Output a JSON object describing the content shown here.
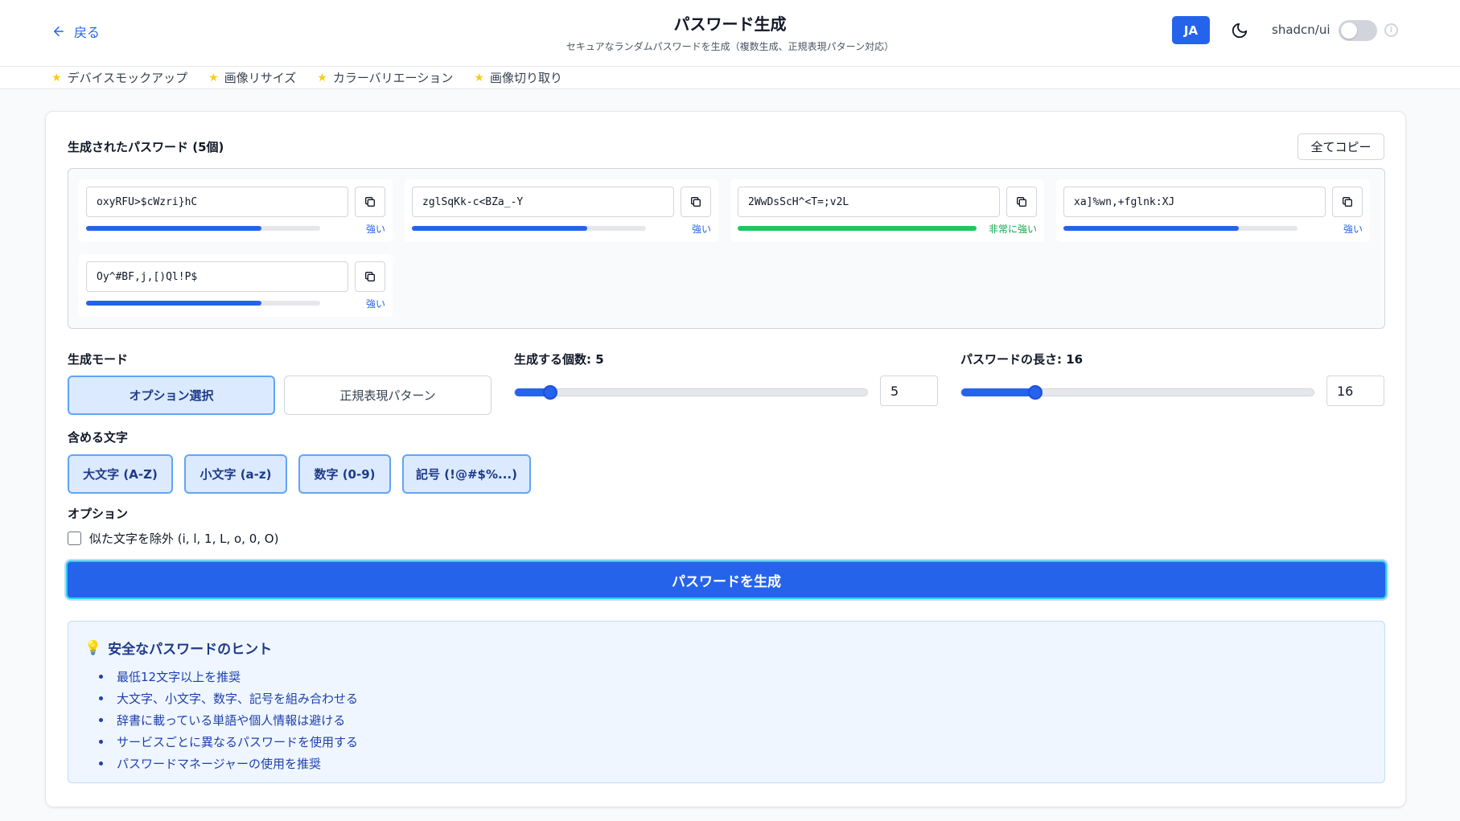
{
  "header": {
    "back_label": "戻る",
    "title": "パスワード生成",
    "subtitle": "セキュアなランダムパスワードを生成（複数生成、正規表現パターン対応）",
    "lang_button": "JA",
    "shadcn_label": "shadcn/ui",
    "shadcn_enabled": false
  },
  "favorites": [
    {
      "label": "デバイスモックアップ"
    },
    {
      "label": "画像リサイズ"
    },
    {
      "label": "カラーバリエーション"
    },
    {
      "label": "画像切り取り"
    }
  ],
  "generated": {
    "title": "生成されたパスワード (5個)",
    "copy_all_label": "全てコピー",
    "passwords": [
      {
        "value": "oxyRFU>$cWzri}hC",
        "strength": "強い",
        "strength_fraction": 0.75,
        "color": "#2563eb"
      },
      {
        "value": "zglSqKk-c<BZa_-Y",
        "strength": "強い",
        "strength_fraction": 0.75,
        "color": "#2563eb"
      },
      {
        "value": "2WwDsScH^<T=;v2L",
        "strength": "非常に強い",
        "strength_fraction": 1.0,
        "color": "#22c55e"
      },
      {
        "value": "xa]%wn,+fglnk:XJ",
        "strength": "強い",
        "strength_fraction": 0.75,
        "color": "#2563eb"
      },
      {
        "value": "Oy^#BF,j,[)Ql!P$",
        "strength": "強い",
        "strength_fraction": 0.75,
        "color": "#2563eb"
      }
    ]
  },
  "mode": {
    "label": "生成モード",
    "options": [
      "オプション選択",
      "正規表現パターン"
    ],
    "selected": "オプション選択"
  },
  "count": {
    "label": "生成する個数: 5",
    "value": "5",
    "slider_fraction": 0.1
  },
  "length": {
    "label": "パスワードの長さ: 16",
    "value": "16",
    "slider_fraction": 0.21
  },
  "charsets": {
    "label": "含める文字",
    "items": [
      "大文字 (A-Z)",
      "小文字 (a-z)",
      "数字 (0-9)",
      "記号 (!@#$%...)"
    ]
  },
  "options": {
    "label": "オプション",
    "exclude_similar_label": "似た文字を除外 (i, l, 1, L, o, 0, O)",
    "exclude_similar_checked": false
  },
  "generate_button": "パスワードを生成",
  "tips": {
    "title": "安全なパスワードのヒント",
    "items": [
      "最低12文字以上を推奨",
      "大文字、小文字、数字、記号を組み合わせる",
      "辞書に載っている単語や個人情報は避ける",
      "サービスごとに異なるパスワードを使用する",
      "パスワードマネージャーの使用を推奨"
    ]
  }
}
